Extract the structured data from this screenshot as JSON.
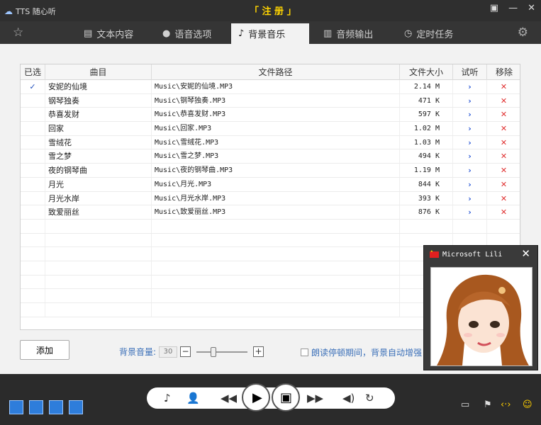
{
  "app": {
    "title": "TTS 随心听",
    "register": "「 注 册 」"
  },
  "tabs": [
    {
      "label": "文本内容"
    },
    {
      "label": "语音选项"
    },
    {
      "label": "背景音乐"
    },
    {
      "label": "音频输出"
    },
    {
      "label": "定时任务"
    }
  ],
  "table": {
    "headers": [
      "已选",
      "曲目",
      "文件路径",
      "文件大小",
      "试听",
      "移除"
    ],
    "rows": [
      {
        "sel": "✓",
        "name": "安妮的仙境",
        "path": "Music\\安妮的仙境.MP3",
        "size": "2.14 M"
      },
      {
        "sel": "",
        "name": "钢琴独奏",
        "path": "Music\\钢琴独奏.MP3",
        "size": "471 K"
      },
      {
        "sel": "",
        "name": "恭喜发财",
        "path": "Music\\恭喜发财.MP3",
        "size": "597 K"
      },
      {
        "sel": "",
        "name": "回家",
        "path": "Music\\回家.MP3",
        "size": "1.02 M"
      },
      {
        "sel": "",
        "name": "雪绒花",
        "path": "Music\\雪绒花.MP3",
        "size": "1.03 M"
      },
      {
        "sel": "",
        "name": "雪之梦",
        "path": "Music\\雪之梦.MP3",
        "size": "494 K"
      },
      {
        "sel": "",
        "name": "夜的钢琴曲",
        "path": "Music\\夜的钢琴曲.MP3",
        "size": "1.19 M"
      },
      {
        "sel": "",
        "name": "月光",
        "path": "Music\\月光.MP3",
        "size": "844 K"
      },
      {
        "sel": "",
        "name": "月光水岸",
        "path": "Music\\月光水岸.MP3",
        "size": "393 K"
      },
      {
        "sel": "",
        "name": "致爱丽丝",
        "path": "Music\\致爱丽丝.MP3",
        "size": "876 K"
      }
    ],
    "play_glyph": "›",
    "remove_glyph": "✕"
  },
  "controls": {
    "add_label": "添加",
    "volume_label": "背景音量:",
    "volume_value": "30",
    "volume_minus": "−",
    "volume_plus": "+",
    "auto_boost_label": "朗读停顿期间，背景自动增强"
  },
  "agent": {
    "name": "Microsoft Lili"
  },
  "colors": {
    "accent": "#2e7ddb",
    "remove": "#e03030",
    "register": "#ffd400"
  }
}
